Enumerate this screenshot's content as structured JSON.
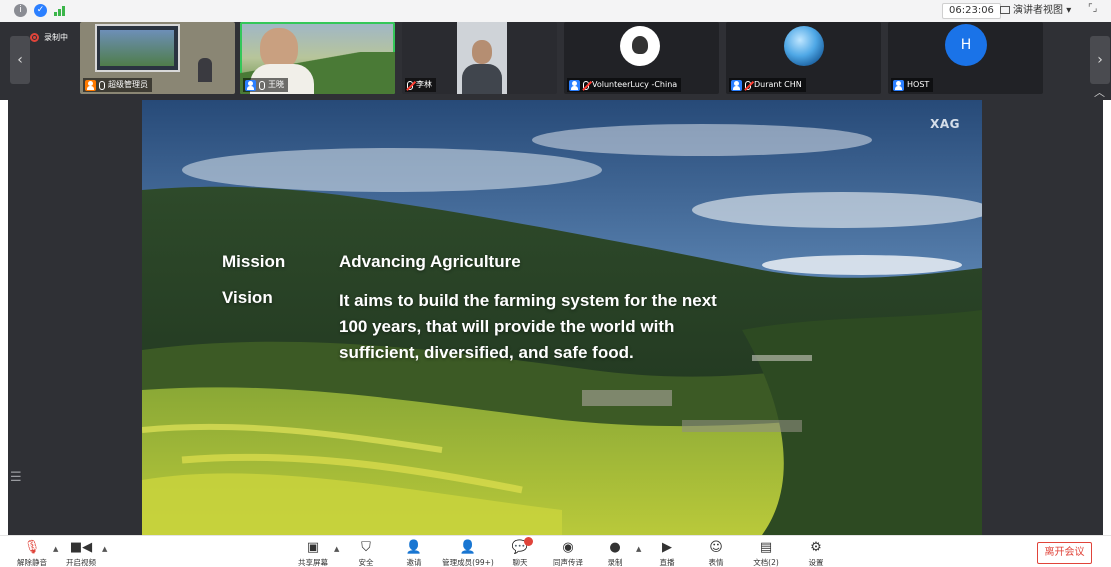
{
  "topbar": {
    "timer": "06:23:06",
    "view_mode": "演讲者视图"
  },
  "recording": {
    "label": "录制中"
  },
  "participants": [
    {
      "name": "超级管理员",
      "role": "host"
    },
    {
      "name": "王晓",
      "role": "co-host"
    },
    {
      "name": "李林",
      "role": "participant"
    },
    {
      "name": "",
      "role": "participant"
    },
    {
      "name": "VolunteerLucy -China",
      "role": "co-host"
    },
    {
      "name": "Durant CHN",
      "role": "co-host"
    },
    {
      "name": "HOST",
      "role": "co-host",
      "avatar_letter": "H"
    }
  ],
  "slide": {
    "logo": "XAG",
    "mission_label": "Mission",
    "mission_text": "Advancing Agriculture",
    "vision_label": "Vision",
    "vision_line1": "It aims to build the farming system for the next",
    "vision_line2": "100 years, that will provide the world with",
    "vision_line3": "sufficient, diversified, and safe food."
  },
  "toolbar": {
    "unmute": "解除静音",
    "start_video": "开启视频",
    "share_screen": "共享屏幕",
    "security": "安全",
    "invite": "邀请",
    "manage_members": "管理成员(99+)",
    "chat": "聊天",
    "chat_badge": "",
    "interpretation": "同声传译",
    "record": "录制",
    "live": "直播",
    "reactions": "表情",
    "documents": "文档(2)",
    "settings": "设置",
    "leave": "离开会议"
  },
  "colors": {
    "strip_bg": "#2f3035",
    "stage_bg": "#2f3035",
    "leave_red": "#e0443a",
    "host_badge": "#ff7a00",
    "cohost_badge": "#2b7fff",
    "avatar_blue": "#1a73e8"
  }
}
